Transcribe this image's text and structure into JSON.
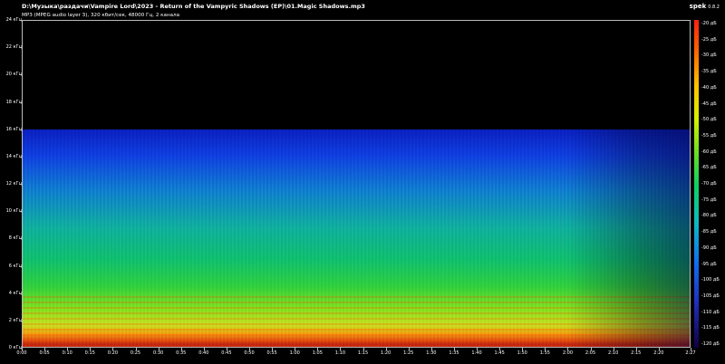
{
  "header": {
    "file_path": "D:\\Музыка\\раздачи\\Vampire Lord\\2023 - Return of the Vampyric Shadows (EP)\\01.Magic Shadows.mp3",
    "info": "MP3 (MPEG audio layer 3), 320 кбит/сек, 48000 Гц, 2 канала",
    "brand_name": "spek",
    "brand_version": "0.8.2"
  },
  "y_axis": {
    "ticks": [
      "24 кГц",
      "22 кГц",
      "20 кГц",
      "18 кГц",
      "16 кГц",
      "14 кГц",
      "12 кГц",
      "10 кГц",
      "8 кГц",
      "6 кГц",
      "4 кГц",
      "2 кГц",
      "0 кГц"
    ]
  },
  "x_axis": {
    "ticks": [
      "0:00",
      "0:05",
      "0:10",
      "0:15",
      "0:20",
      "0:25",
      "0:30",
      "0:35",
      "0:40",
      "0:45",
      "0:50",
      "0:55",
      "1:00",
      "1:05",
      "1:10",
      "1:15",
      "1:20",
      "1:25",
      "1:30",
      "1:35",
      "1:40",
      "1:45",
      "1:50",
      "1:55",
      "2:00",
      "2:05",
      "2:10",
      "2:15",
      "2:20",
      "2:27"
    ]
  },
  "colorbar": {
    "ticks": [
      "-20 дБ",
      "-25 дБ",
      "-30 дБ",
      "-35 дБ",
      "-40 дБ",
      "-45 дБ",
      "-50 дБ",
      "-55 дБ",
      "-60 дБ",
      "-65 дБ",
      "-70 дБ",
      "-75 дБ",
      "-80 дБ",
      "-85 дБ",
      "-90 дБ",
      "-95 дБ",
      "-100 дБ",
      "-105 дБ",
      "-110 дБ",
      "-115 дБ",
      "-120 дБ"
    ]
  },
  "spectrogram": {
    "frequency_cutoff_khz": 16,
    "duration": "2:27",
    "palette": [
      "#ff2010",
      "#ffc000",
      "#70e020",
      "#10b8c0",
      "#1070f0",
      "#100040"
    ]
  }
}
